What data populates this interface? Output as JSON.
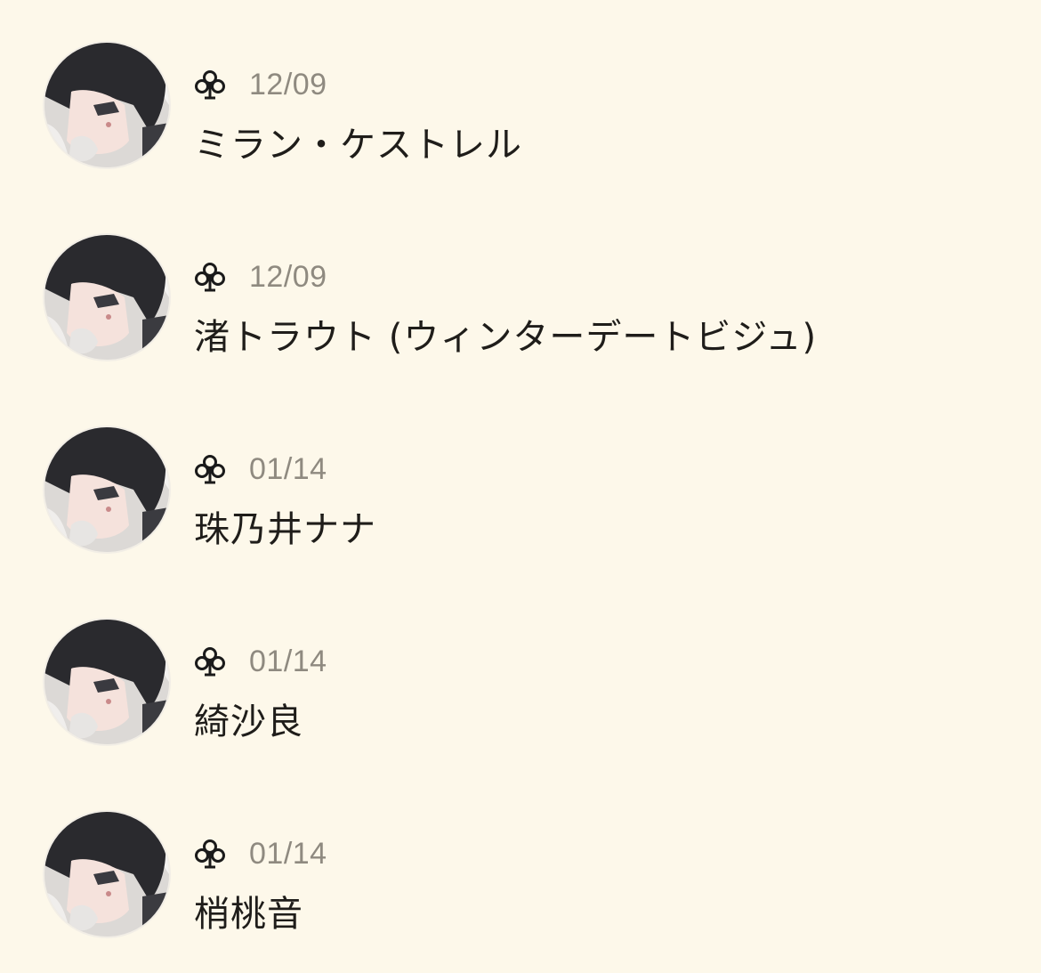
{
  "colors": {
    "background": "#fdf8ea",
    "date_text": "#8f8a80",
    "name_text": "#1f1d1a",
    "icon": "#1a1a1a"
  },
  "entries": [
    {
      "icon": "club-icon",
      "date": "12/09",
      "name": "ミラン・ケストレル"
    },
    {
      "icon": "club-icon",
      "date": "12/09",
      "name": "渚トラウト (ウィンターデートビジュ)"
    },
    {
      "icon": "club-icon",
      "date": "01/14",
      "name": "珠乃井ナナ"
    },
    {
      "icon": "club-icon",
      "date": "01/14",
      "name": "綺沙良"
    },
    {
      "icon": "club-icon",
      "date": "01/14",
      "name": "梢桃音"
    }
  ]
}
